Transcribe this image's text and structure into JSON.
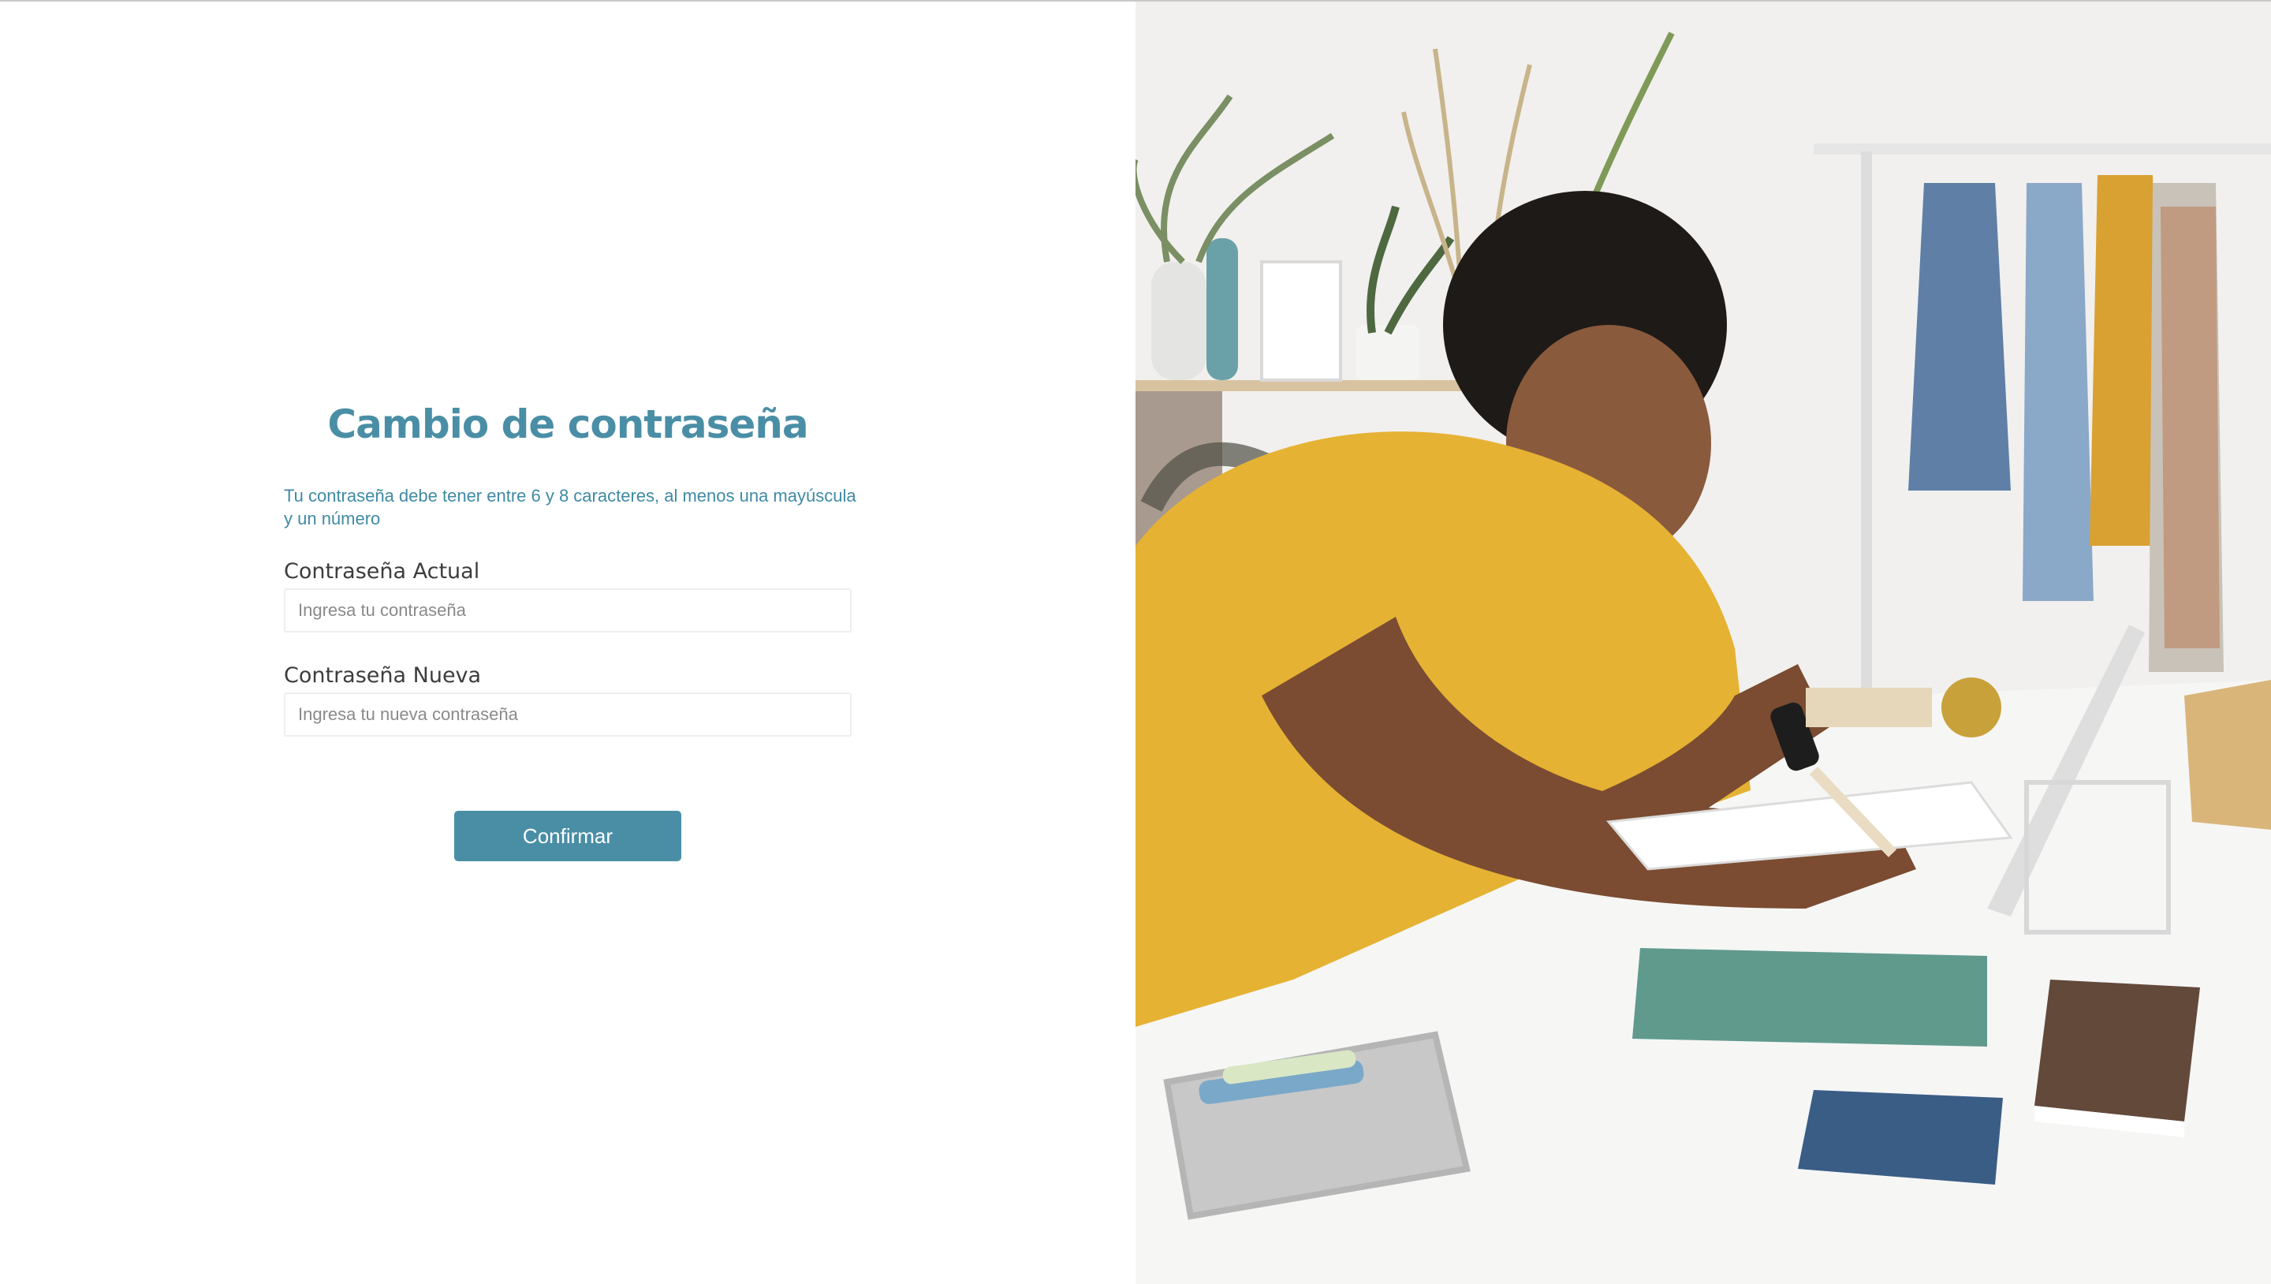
{
  "form": {
    "title": "Cambio de contraseña",
    "hint": "Tu contraseña debe tener entre 6 y 8 caracteres, al menos una mayúscula y un número",
    "current_password": {
      "label": "Contraseña Actual",
      "placeholder": "Ingresa tu contraseña",
      "value": ""
    },
    "new_password": {
      "label": "Contraseña Nueva",
      "placeholder": "Ingresa tu nueva contraseña",
      "value": ""
    },
    "confirm_label": "Confirmar"
  },
  "colors": {
    "accent": "#4a8ea6",
    "hint_text": "#3f8aa4",
    "label_text": "#3d3d3d"
  },
  "hero_image": {
    "description": "student-writing-at-desk-photo"
  }
}
